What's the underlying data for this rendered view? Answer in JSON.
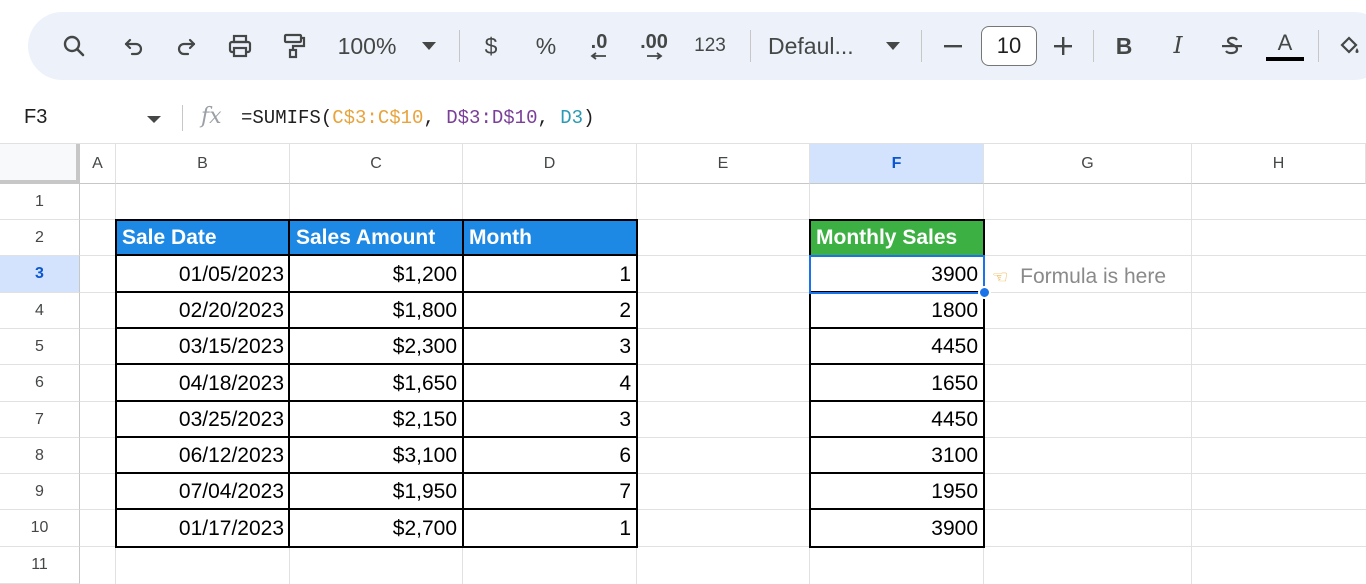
{
  "toolbar": {
    "zoom": "100%",
    "currency_label": "$",
    "percent_label": "%",
    "decrease_decimal_label": ".0",
    "increase_decimal_label": ".00",
    "number_format_label": "123",
    "font_name": "Defaul...",
    "font_size": "10",
    "bold_label": "B",
    "italic_label": "I",
    "text_color_label": "A",
    "icons": [
      "search-icon",
      "undo-icon",
      "redo-icon",
      "print-icon",
      "paint-format-icon",
      "chevron-down-icon",
      "minus-icon",
      "plus-icon",
      "strikethrough-icon",
      "text-color-icon",
      "fill-color-icon"
    ]
  },
  "formula_bar": {
    "name_box": "F3",
    "fx_label": "fx",
    "formula_prefix": "=SUMIFS(",
    "arg1": "C$3:C$10",
    "sep1": ", ",
    "arg2": "D$3:D$10",
    "sep2": ", ",
    "arg3": "D3",
    "formula_suffix": ")",
    "arg_colors": [
      "#e8a33d",
      "#7a3f98",
      "#2a9bb5"
    ]
  },
  "grid": {
    "columns": [
      "A",
      "B",
      "C",
      "D",
      "E",
      "F",
      "G",
      "H"
    ],
    "rows": [
      "1",
      "2",
      "3",
      "4",
      "5",
      "6",
      "7",
      "8",
      "9",
      "10",
      "11"
    ],
    "selected_cell": "F3",
    "headers": {
      "sale_date": "Sale Date",
      "sales_amount": "Sales Amount",
      "month": "Month",
      "monthly_sales": "Monthly Sales"
    },
    "header_colors": {
      "blue": "#1e88e5",
      "green": "#3cb043"
    },
    "data": [
      {
        "date": "01/05/2023",
        "amount": "$1,200",
        "month": "1",
        "monthly": "3900"
      },
      {
        "date": "02/20/2023",
        "amount": "$1,800",
        "month": "2",
        "monthly": "1800"
      },
      {
        "date": "03/15/2023",
        "amount": "$2,300",
        "month": "3",
        "monthly": "4450"
      },
      {
        "date": "04/18/2023",
        "amount": "$1,650",
        "month": "4",
        "monthly": "1650"
      },
      {
        "date": "03/25/2023",
        "amount": "$2,150",
        "month": "3",
        "monthly": "4450"
      },
      {
        "date": "06/12/2023",
        "amount": "$3,100",
        "month": "6",
        "monthly": "3100"
      },
      {
        "date": "07/04/2023",
        "amount": "$1,950",
        "month": "7",
        "monthly": "1950"
      },
      {
        "date": "01/17/2023",
        "amount": "$2,700",
        "month": "1",
        "monthly": "3900"
      }
    ],
    "note_icon": "pointing-hand-icon",
    "note_text": "Formula is here"
  }
}
